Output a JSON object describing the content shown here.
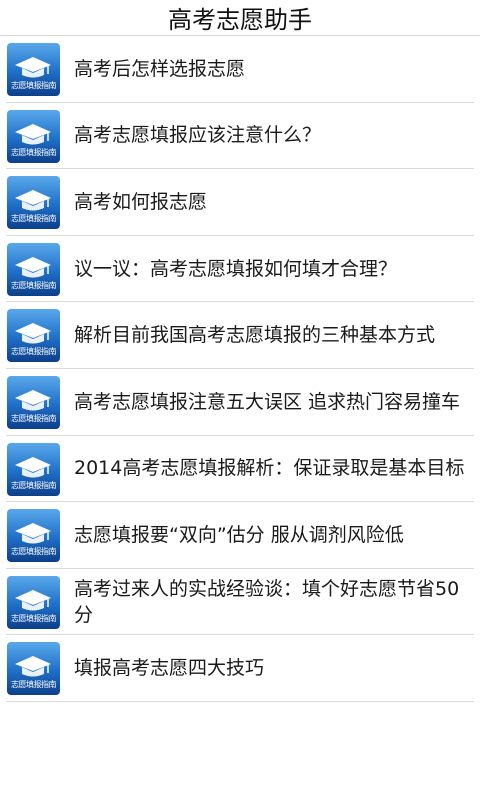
{
  "header": {
    "title": "高考志愿助手"
  },
  "thumb_caption": "志愿填报指南",
  "colors": {
    "thumb_top": "#5aa8ea",
    "thumb_bottom": "#0d3f8a",
    "divider": "#d9d9d9"
  },
  "items": [
    {
      "title": "高考后怎样选报志愿"
    },
    {
      "title": "高考志愿填报应该注意什么？"
    },
    {
      "title": "高考如何报志愿"
    },
    {
      "title": "议一议：高考志愿填报如何填才合理？"
    },
    {
      "title": "解析目前我国高考志愿填报的三种基本方式"
    },
    {
      "title": "高考志愿填报注意五大误区 追求热门容易撞车"
    },
    {
      "title": "2014高考志愿填报解析：保证录取是基本目标"
    },
    {
      "title": "志愿填报要“双向”估分 服从调剂风险低"
    },
    {
      "title": "高考过来人的实战经验谈：填个好志愿节省50分"
    },
    {
      "title": "填报高考志愿四大技巧"
    }
  ]
}
